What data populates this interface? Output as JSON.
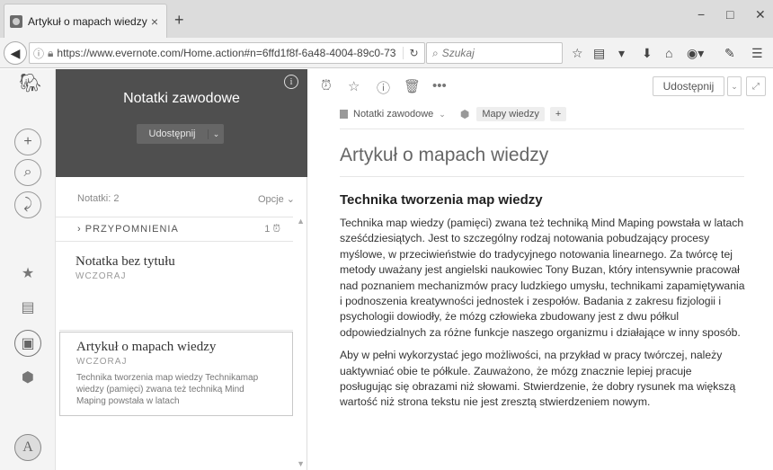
{
  "browser": {
    "tab_title": "Artykuł o mapach wiedzy |...",
    "tab_close": "×",
    "new_tab": "+",
    "url": "https://www.evernote.com/Home.action#n=6ffd1f8f-6a48-4004-89c0-73",
    "search_placeholder": "Szukaj",
    "win_min": "−",
    "win_max": "□",
    "win_close": "✕"
  },
  "notebook": {
    "title": "Notatki zawodowe",
    "share_label": "Udostępnij",
    "info": "i"
  },
  "list": {
    "count_label": "Notatki: 2",
    "options_label": "Opcje",
    "reminders_label": "PRZYPOMNIENIA",
    "reminders_count": "1",
    "notes": [
      {
        "title": "Notatka bez tytułu",
        "date": "WCZORAJ",
        "snippet": ""
      },
      {
        "title": "Artykuł o mapach wiedzy",
        "date": "WCZORAJ",
        "snippet": "Technika tworzenia map wiedzy Technikamap wiedzy (pamięci) zwana też techniką Mind Maping powstała w latach"
      }
    ]
  },
  "editor": {
    "share_label": "Udostępnij",
    "notebook_name": "Notatki zawodowe",
    "tag": "Mapy wiedzy",
    "add_tag": "+",
    "title": "Artykuł o mapach wiedzy",
    "heading": "Technika tworzenia map wiedzy",
    "paragraph1": "Technika map wiedzy (pamięci) zwana też techniką Mind Maping powstała w latach sześćdziesiątych. Jest to szczególny rodzaj notowania pobudzający procesy myślowe, w przeciwieństwie do tradycyjnego notowania linearnego. Za twórcę tej metody uważany jest angielski naukowiec Tony Buzan, który intensywnie pracował nad poznaniem mechanizmów pracy ludzkiego umysłu, technikami zapamiętywania i podnoszenia kreatywności jednostek i zespołów. Badania z zakresu fizjologii i psychologii dowiodły, że mózg człowieka zbudowany jest z dwu półkul odpowiedzialnych za różne funkcje naszego organizmu i działające w inny sposób.",
    "paragraph2": "Aby w pełni wykorzystać jego możliwości, na przykład w pracy twórczej, należy uaktywniać obie te półkule. Zauważono, że mózg znacznie lepiej pracuje posługując się obrazami niż słowami. Stwierdzenie, że dobry rysunek ma większą wartość niż strona tekstu nie jest zresztą stwierdzeniem nowym."
  },
  "icons": {
    "elephant": "elephant-logo-icon",
    "add": "+",
    "search": "⌕",
    "chat": "chat-icon",
    "star": "★",
    "notes": "notes-icon",
    "notebooks": "notebook-icon",
    "tags": "tag-icon",
    "avatar_letter": "A"
  }
}
